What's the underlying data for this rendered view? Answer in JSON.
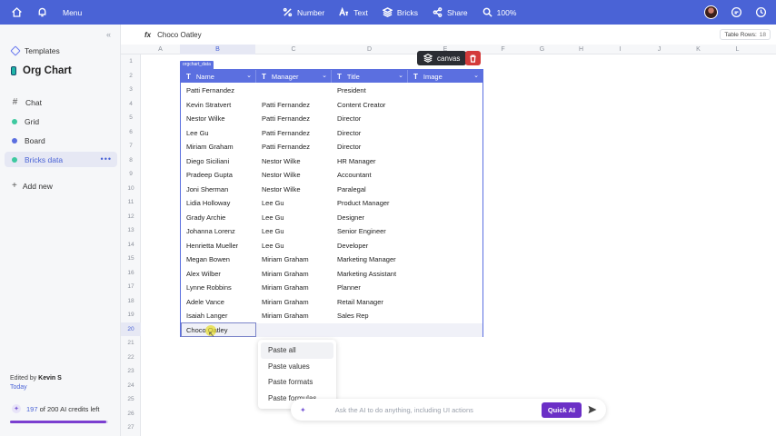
{
  "topbar": {
    "menu_label": "Menu",
    "center": [
      {
        "icon": "percent-icon",
        "label": "Number"
      },
      {
        "icon": "text-icon",
        "label": "Text"
      },
      {
        "icon": "bricks-icon",
        "label": "Bricks"
      },
      {
        "icon": "share-icon",
        "label": "Share"
      },
      {
        "icon": "zoom-icon",
        "label": "100%"
      }
    ]
  },
  "sidebar": {
    "templates_label": "Templates",
    "doc_title": "Org Chart",
    "items": [
      {
        "label": "Chat",
        "icon": "hash-icon"
      },
      {
        "label": "Grid",
        "icon": "dot-icon",
        "color": "#3ec9a0"
      },
      {
        "label": "Board",
        "icon": "dot-icon",
        "color": "#5b6fe0"
      },
      {
        "label": "Bricks data",
        "icon": "dot-icon",
        "color": "#3ec9a0"
      }
    ],
    "add_new_label": "Add new",
    "edited_by_prefix": "Edited by",
    "edited_by_name": "Kevin S",
    "edited_when": "Today",
    "credits_used": "197",
    "credits_suffix": "of 200 AI credits left",
    "credits_fraction": 0.985
  },
  "formula": {
    "fx_label": "fx",
    "value": "Choco Oatley",
    "table_rows_label": "Table Rows:",
    "table_rows_value": "18"
  },
  "grid": {
    "columns": [
      "A",
      "B",
      "C",
      "D",
      "E",
      "F",
      "G",
      "H",
      "I",
      "J",
      "K",
      "L"
    ],
    "rows": [
      "1",
      "2",
      "3",
      "4",
      "5",
      "6",
      "7",
      "8",
      "9",
      "10",
      "11",
      "12",
      "13",
      "14",
      "15",
      "16",
      "17",
      "18",
      "19",
      "20",
      "21",
      "22",
      "23",
      "24",
      "25",
      "26",
      "27"
    ],
    "selected_column": "B",
    "selected_row": "20"
  },
  "brick": {
    "tag": "orgchart_data",
    "headers": [
      "Name",
      "Manager",
      "Title",
      "Image"
    ],
    "rows": [
      [
        "Patti Fernandez",
        "",
        "President",
        ""
      ],
      [
        "Kevin Stratvert",
        "Patti Fernandez",
        "Content Creator",
        ""
      ],
      [
        "Nestor Wilke",
        "Patti Fernandez",
        "Director",
        ""
      ],
      [
        "Lee Gu",
        "Patti Fernandez",
        "Director",
        ""
      ],
      [
        "Miriam Graham",
        "Patti Fernandez",
        "Director",
        ""
      ],
      [
        "Diego Siciliani",
        "Nestor Wilke",
        "HR Manager",
        ""
      ],
      [
        "Pradeep Gupta",
        "Nestor Wilke",
        "Accountant",
        ""
      ],
      [
        "Joni Sherman",
        "Nestor Wilke",
        "Paralegal",
        ""
      ],
      [
        "Lidia Holloway",
        "Lee Gu",
        "Product Manager",
        ""
      ],
      [
        "Grady Archie",
        "Lee Gu",
        "Designer",
        ""
      ],
      [
        "Johanna Lorenz",
        "Lee Gu",
        "Senior Engineer",
        ""
      ],
      [
        "Henrietta Mueller",
        "Lee Gu",
        "Developer",
        ""
      ],
      [
        "Megan Bowen",
        "Miriam Graham",
        "Marketing Manager",
        ""
      ],
      [
        "Alex Wilber",
        "Miriam Graham",
        "Marketing Assistant",
        ""
      ],
      [
        "Lynne Robbins",
        "Miriam Graham",
        "Planner",
        ""
      ],
      [
        "Adele Vance",
        "Miriam Graham",
        "Retail Manager",
        ""
      ],
      [
        "Isaiah Langer",
        "Miriam Graham",
        "Sales Rep",
        ""
      ],
      [
        "Choco Oatley",
        "",
        "",
        ""
      ]
    ],
    "canvas_label": "canvas"
  },
  "context_menu": [
    "Paste all",
    "Paste values",
    "Paste formats",
    "Paste formulas"
  ],
  "ai": {
    "placeholder": "Ask the AI to do anything, including UI actions",
    "button": "Quick AI"
  }
}
